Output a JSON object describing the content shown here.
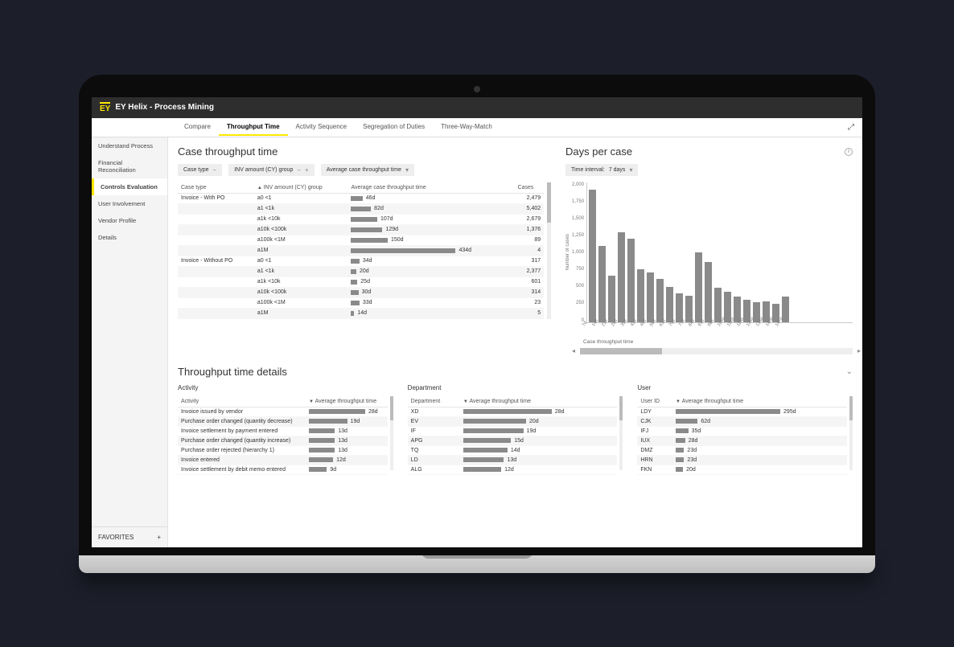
{
  "header": {
    "logo": "EY",
    "title": "EY Helix - Process Mining"
  },
  "tabs": [
    "Compare",
    "Throughput Time",
    "Activity Sequence",
    "Segregation of Duties",
    "Three-Way-Match"
  ],
  "active_tab": 1,
  "sidebar": {
    "items": [
      "Understand Process",
      "Financial Reconciliation",
      "Controls Evaluation",
      "User Involvement",
      "Vendor Profile",
      "Details"
    ],
    "active": 2,
    "favorites_label": "FAVORITES"
  },
  "case_throughput": {
    "title": "Case throughput time",
    "pill_case_type": "Case type",
    "pill_group": "INV amount (CY) group",
    "pill_measure": "Average case throughput time",
    "table": {
      "headers": [
        "Case type",
        "INV amount (CY) group",
        "Average case throughput time",
        "Cases"
      ],
      "groups": [
        {
          "case_type": "Invoice - With PO",
          "rows": [
            {
              "grp": "a0 <1",
              "label": "46d",
              "bar": 11,
              "cases": 2479
            },
            {
              "grp": "a1 <1k",
              "label": "82d",
              "bar": 19,
              "cases": 5402
            },
            {
              "grp": "a1k <10k",
              "label": "107d",
              "bar": 25,
              "cases": 2679
            },
            {
              "grp": "a10k <100k",
              "label": "129d",
              "bar": 30,
              "cases": 1376
            },
            {
              "grp": "a100k <1M",
              "label": "150d",
              "bar": 35,
              "cases": 89
            },
            {
              "grp": "a1M",
              "label": "434d",
              "bar": 100,
              "cases": 4
            }
          ]
        },
        {
          "case_type": "Invoice - Without PO",
          "rows": [
            {
              "grp": "a0 <1",
              "label": "34d",
              "bar": 8,
              "cases": 317
            },
            {
              "grp": "a1 <1k",
              "label": "20d",
              "bar": 5,
              "cases": 2377
            },
            {
              "grp": "a1k <10k",
              "label": "25d",
              "bar": 6,
              "cases": 601
            },
            {
              "grp": "a10k <100k",
              "label": "30d",
              "bar": 7,
              "cases": 314
            },
            {
              "grp": "a100k <1M",
              "label": "33d",
              "bar": 8,
              "cases": 23
            },
            {
              "grp": "a1M",
              "label": "14d",
              "bar": 3,
              "cases": 5
            }
          ]
        }
      ]
    }
  },
  "days_per_case": {
    "title": "Days per case",
    "pill_interval_label": "Time interval:",
    "pill_interval_value": "7 days",
    "y_label": "Number of cases",
    "x_label": "Case throughput time",
    "y_ticks": [
      "2,000",
      "1,750",
      "1,500",
      "1,250",
      "1,000",
      "750",
      "500",
      "250",
      "0"
    ],
    "x_ticks": [
      "7d",
      "14d",
      "21d",
      "28d",
      "35d",
      "42d",
      "49d",
      "56d",
      "63d",
      "70d",
      "77d",
      "84d",
      "91d",
      "98d",
      "105d",
      "112d",
      "119d",
      "126d",
      "133d",
      "140d",
      "147d"
    ]
  },
  "chart_data": {
    "type": "bar",
    "title": "Days per case",
    "xlabel": "Case throughput time",
    "ylabel": "Number of cases",
    "ylim": [
      0,
      2000
    ],
    "categories": [
      "7d",
      "14d",
      "21d",
      "28d",
      "35d",
      "42d",
      "49d",
      "56d",
      "63d",
      "70d",
      "77d",
      "84d",
      "91d",
      "98d",
      "105d",
      "112d",
      "119d",
      "126d",
      "133d",
      "140d",
      "147d"
    ],
    "values": [
      2000,
      1150,
      700,
      1350,
      1250,
      800,
      750,
      650,
      530,
      430,
      400,
      1050,
      900,
      520,
      450,
      380,
      330,
      300,
      310,
      270,
      380
    ]
  },
  "details": {
    "title": "Throughput time details",
    "activity": {
      "label": "Activity",
      "col1": "Activity",
      "col2": "Average throughput time",
      "rows": [
        {
          "name": "Invoice issued by vendor",
          "label": "28d",
          "bar": 100
        },
        {
          "name": "Purchase order changed (quantity decrease)",
          "label": "19d",
          "bar": 68
        },
        {
          "name": "Invoice settlement by payment entered",
          "label": "13d",
          "bar": 46
        },
        {
          "name": "Purchase order changed (quantity increase)",
          "label": "13d",
          "bar": 46
        },
        {
          "name": "Purchase order rejected (hierarchy 1)",
          "label": "13d",
          "bar": 46
        },
        {
          "name": "Invoice entered",
          "label": "12d",
          "bar": 43
        },
        {
          "name": "Invoice settlement by debit memo entered",
          "label": "9d",
          "bar": 32
        }
      ]
    },
    "department": {
      "label": "Department",
      "col1": "Department",
      "col2": "Average throughput time",
      "rows": [
        {
          "name": "XD",
          "label": "28d",
          "bar": 100
        },
        {
          "name": "EV",
          "label": "20d",
          "bar": 71
        },
        {
          "name": "IF",
          "label": "19d",
          "bar": 68
        },
        {
          "name": "APG",
          "label": "15d",
          "bar": 54
        },
        {
          "name": "TQ",
          "label": "14d",
          "bar": 50
        },
        {
          "name": "LD",
          "label": "13d",
          "bar": 46
        },
        {
          "name": "ALG",
          "label": "12d",
          "bar": 43
        }
      ]
    },
    "user": {
      "label": "User",
      "col1": "User ID",
      "col2": "Average throughput time",
      "rows": [
        {
          "name": "LDY",
          "label": "295d",
          "bar": 100
        },
        {
          "name": "CJK",
          "label": "62d",
          "bar": 21
        },
        {
          "name": "IFJ",
          "label": "35d",
          "bar": 12
        },
        {
          "name": "IUX",
          "label": "28d",
          "bar": 9
        },
        {
          "name": "DMZ",
          "label": "23d",
          "bar": 8
        },
        {
          "name": "HRN",
          "label": "23d",
          "bar": 8
        },
        {
          "name": "FKN",
          "label": "20d",
          "bar": 7
        }
      ]
    }
  }
}
